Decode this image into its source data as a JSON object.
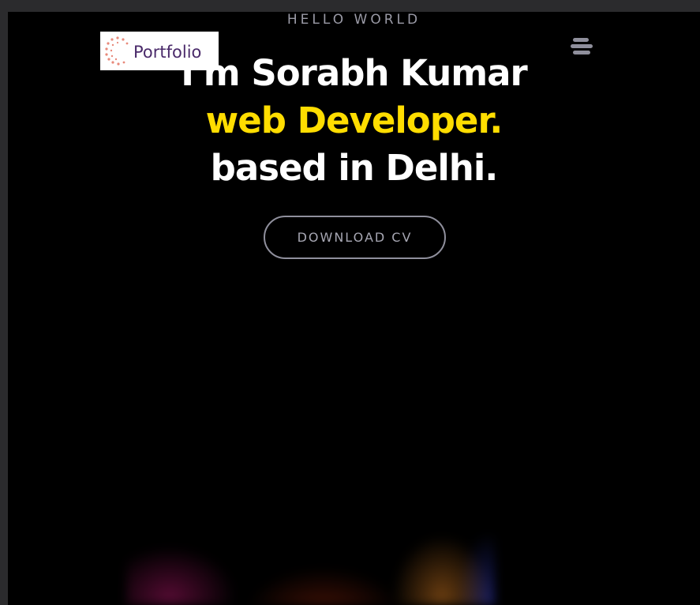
{
  "hero": {
    "eyebrow": "HELLO WORLD",
    "heading_line1": "I'm Sorabh Kumar",
    "heading_line2": "web Developer.",
    "heading_line3": "based in Delhi.",
    "accent_color": "#ffdd00",
    "cv_button_label": "DOWNLOAD CV"
  },
  "header": {
    "logo_text": "Portfolio",
    "menu_icon": "hamburger-icon"
  }
}
